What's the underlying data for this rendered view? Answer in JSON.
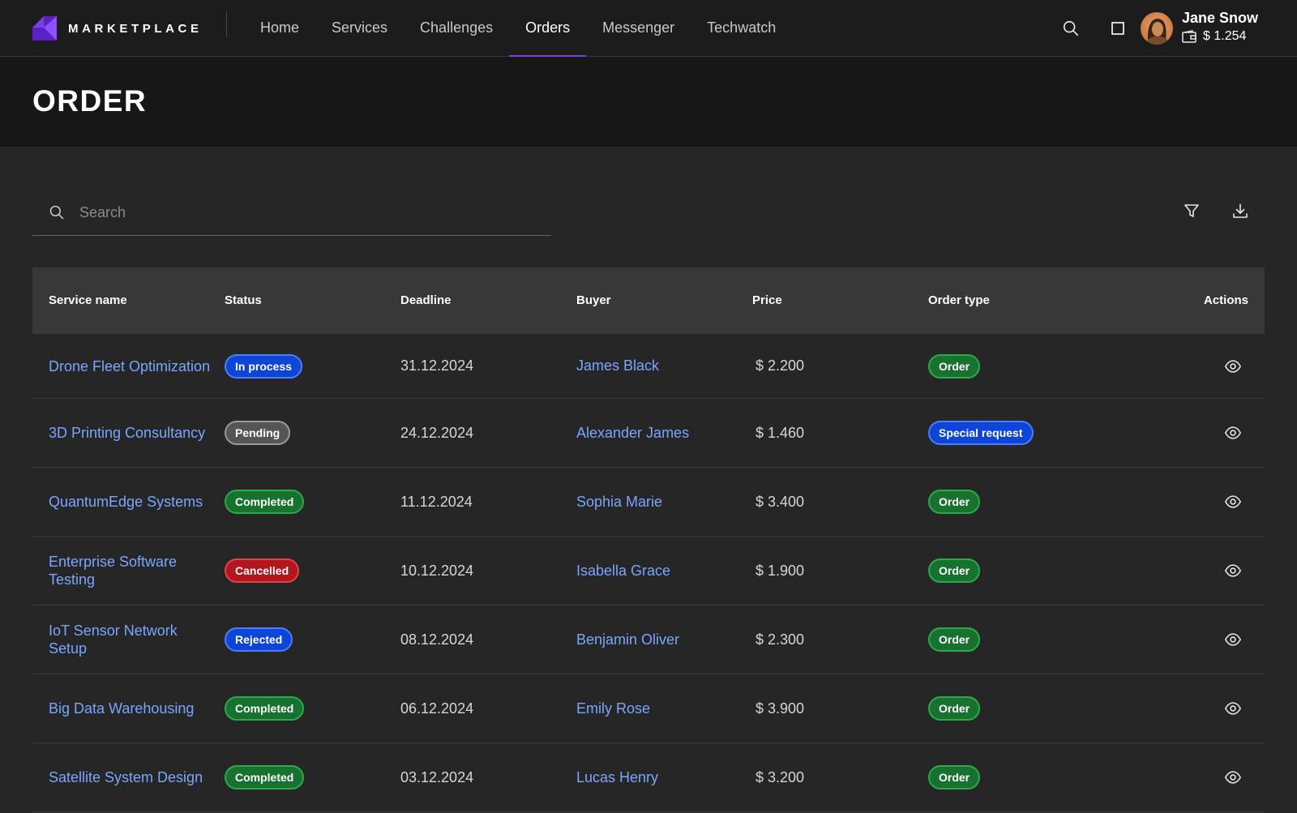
{
  "app": {
    "brand": "MARKETPLACE"
  },
  "nav": {
    "items": [
      {
        "label": "Home",
        "active": false
      },
      {
        "label": "Services",
        "active": false
      },
      {
        "label": "Challenges",
        "active": false
      },
      {
        "label": "Orders",
        "active": true
      },
      {
        "label": "Messenger",
        "active": false
      },
      {
        "label": "Techwatch",
        "active": false
      }
    ]
  },
  "user": {
    "name": "Jane Snow",
    "balance": "$ 1.254"
  },
  "page": {
    "title": "ORDER"
  },
  "toolbar": {
    "search_placeholder": "Search",
    "search_value": ""
  },
  "table": {
    "headers": [
      "Service name",
      "Status",
      "Deadline",
      "Buyer",
      "Price",
      "Order type",
      "Actions"
    ],
    "rows": [
      {
        "service": "Drone Fleet Optimization",
        "status": "In process",
        "status_color": "blue",
        "deadline": "31.12.2024",
        "buyer": "James Black",
        "price": "$ 2.200",
        "order_type": "Order",
        "order_type_color": "green"
      },
      {
        "service": "3D Printing Consultancy",
        "status": "Pending",
        "status_color": "gray",
        "deadline": "24.12.2024",
        "buyer": "Alexander James",
        "price": "$ 1.460",
        "order_type": "Special request",
        "order_type_color": "blue"
      },
      {
        "service": "QuantumEdge Systems",
        "status": "Completed",
        "status_color": "green",
        "deadline": "11.12.2024",
        "buyer": "Sophia Marie",
        "price": "$ 3.400",
        "order_type": "Order",
        "order_type_color": "green"
      },
      {
        "service": "Enterprise Software Testing",
        "status": "Cancelled",
        "status_color": "red",
        "deadline": "10.12.2024",
        "buyer": "Isabella Grace",
        "price": "$ 1.900",
        "order_type": "Order",
        "order_type_color": "green"
      },
      {
        "service": "IoT Sensor Network Setup",
        "status": "Rejected",
        "status_color": "blue",
        "deadline": "08.12.2024",
        "buyer": "Benjamin Oliver",
        "price": "$ 2.300",
        "order_type": "Order",
        "order_type_color": "green"
      },
      {
        "service": "Big Data Warehousing",
        "status": "Completed",
        "status_color": "green",
        "deadline": "06.12.2024",
        "buyer": "Emily Rose",
        "price": "$ 3.900",
        "order_type": "Order",
        "order_type_color": "green"
      },
      {
        "service": "Satellite System Design",
        "status": "Completed",
        "status_color": "green",
        "deadline": "03.12.2024",
        "buyer": "Lucas Henry",
        "price": "$ 3.200",
        "order_type": "Order",
        "order_type_color": "green"
      }
    ]
  },
  "colors": {
    "accent": "#7b3fe4",
    "link": "#79a6ff",
    "badge_blue": "#0d46d6",
    "badge_green": "#18722f",
    "badge_red": "#b3161d",
    "badge_gray": "#555555"
  },
  "icons": {
    "top_search": "search-icon",
    "top_square": "square-icon",
    "wallet": "wallet-icon",
    "filter": "filter-icon",
    "download": "download-icon",
    "row_action": "eye-icon"
  }
}
